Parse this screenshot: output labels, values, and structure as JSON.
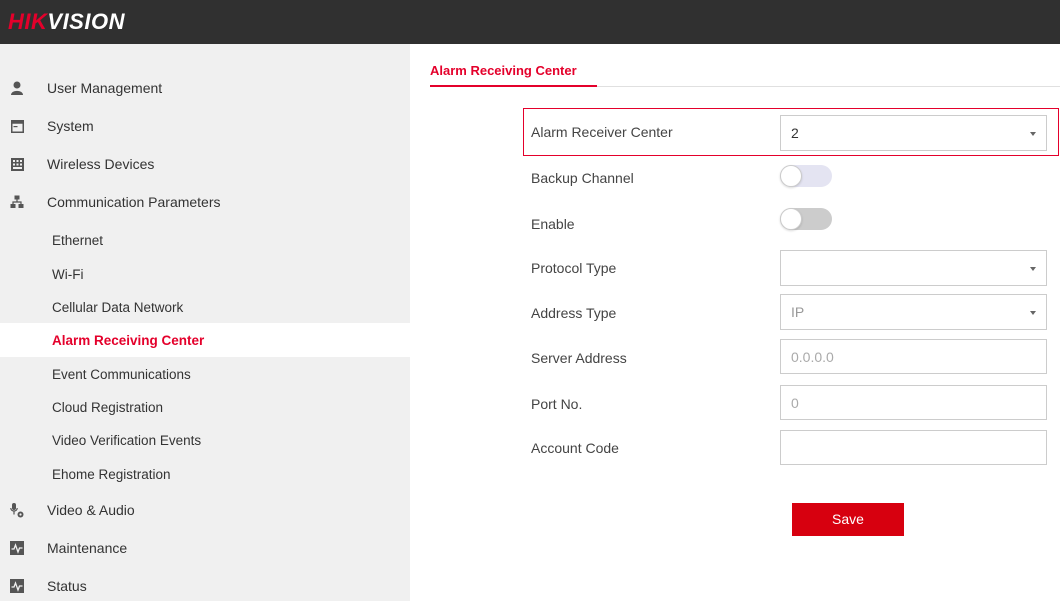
{
  "header": {
    "logo_part1": "HIK",
    "logo_part2": "VISION",
    "brand_color": "#e4002b"
  },
  "sidebar": {
    "items": [
      {
        "label": "User Management",
        "icon": "user-icon",
        "level": 1
      },
      {
        "label": "System",
        "icon": "system-icon",
        "level": 1
      },
      {
        "label": "Wireless Devices",
        "icon": "wireless-devices-icon",
        "level": 1
      },
      {
        "label": "Communication Parameters",
        "icon": "network-icon",
        "level": 1
      },
      {
        "label": "Ethernet",
        "level": 2
      },
      {
        "label": "Wi-Fi",
        "level": 2
      },
      {
        "label": "Cellular Data Network",
        "level": 2
      },
      {
        "label": "Alarm Receiving Center",
        "level": 2,
        "active": true
      },
      {
        "label": "Event Communications",
        "level": 2
      },
      {
        "label": "Cloud Registration",
        "level": 2
      },
      {
        "label": "Video Verification Events",
        "level": 2
      },
      {
        "label": "Ehome Registration",
        "level": 2
      },
      {
        "label": "Video & Audio",
        "icon": "video-audio-icon",
        "level": 1
      },
      {
        "label": "Maintenance",
        "icon": "maintenance-icon",
        "level": 1
      },
      {
        "label": "Status",
        "icon": "status-icon",
        "level": 1
      }
    ]
  },
  "main": {
    "tab_title": "Alarm Receiving Center",
    "fields": {
      "alarm_receiver_center": {
        "label": "Alarm Receiver Center",
        "value": "2"
      },
      "backup_channel": {
        "label": "Backup Channel",
        "state": "disabled"
      },
      "enable": {
        "label": "Enable",
        "state": "off"
      },
      "protocol_type": {
        "label": "Protocol Type",
        "value": ""
      },
      "address_type": {
        "label": "Address Type",
        "value": "IP"
      },
      "server_address": {
        "label": "Server Address",
        "placeholder": "0.0.0.0"
      },
      "port_no": {
        "label": "Port No.",
        "placeholder": "0"
      },
      "account_code": {
        "label": "Account Code",
        "value": ""
      }
    },
    "save_label": "Save"
  }
}
